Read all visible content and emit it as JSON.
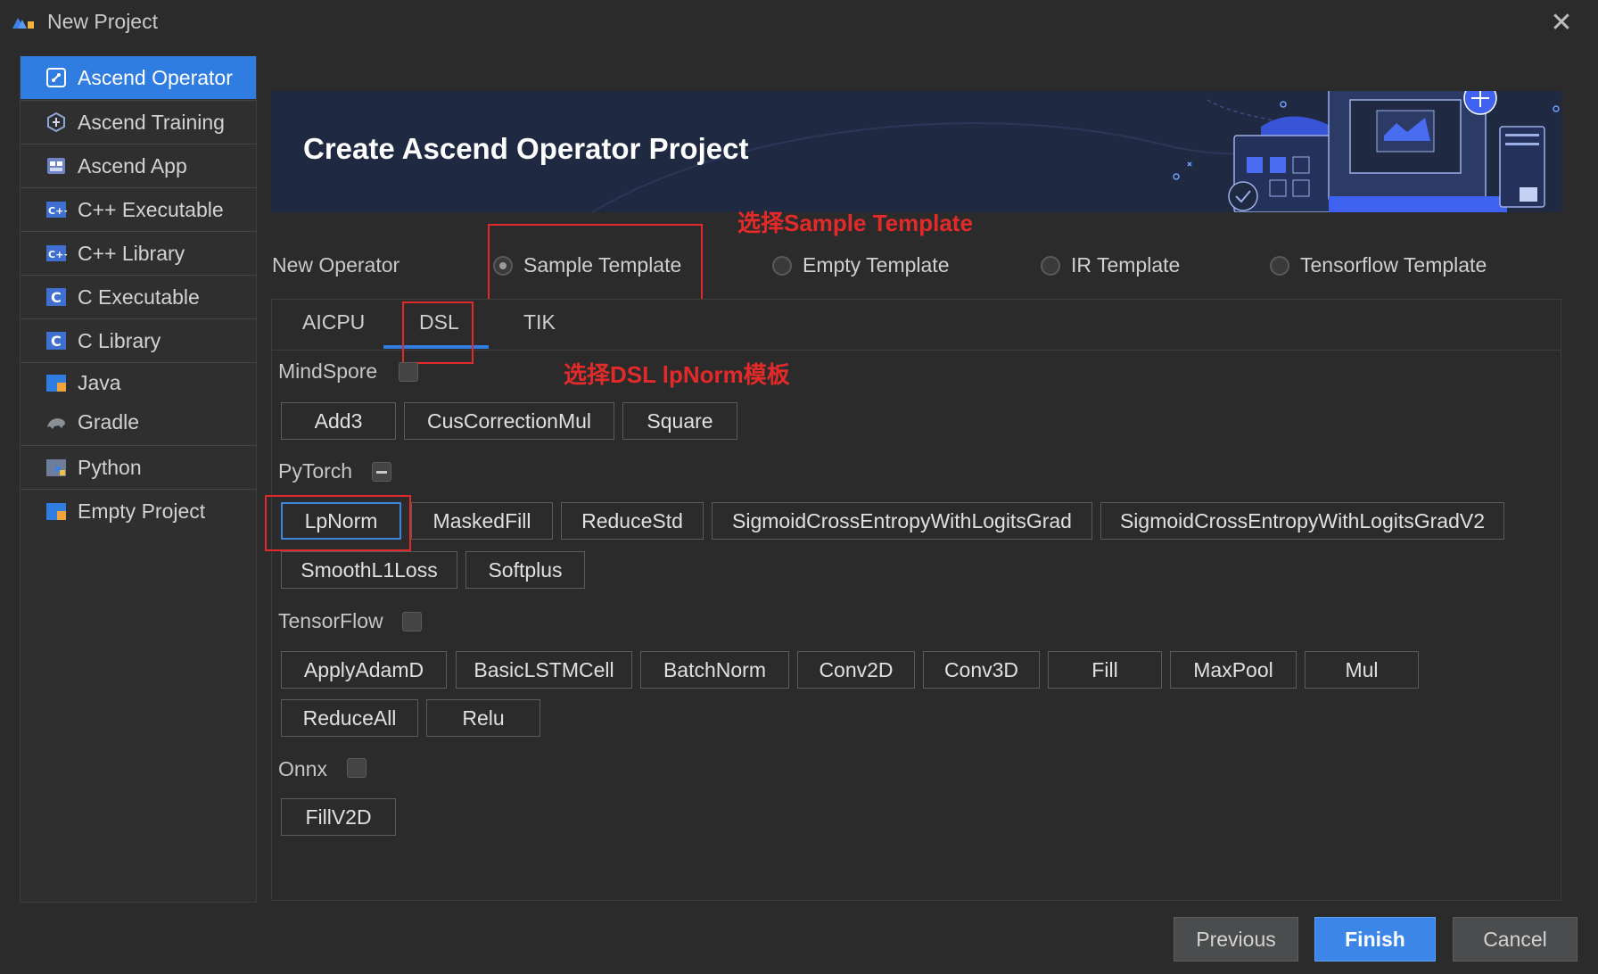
{
  "window": {
    "title": "New Project",
    "close_glyph": "✕"
  },
  "sidebar": {
    "items": [
      {
        "label": "Ascend Operator",
        "icon": "ascend-operator-icon",
        "selected": true
      },
      {
        "label": "Ascend Training",
        "icon": "ascend-training-icon"
      },
      {
        "label": "Ascend App",
        "icon": "ascend-app-icon"
      },
      {
        "label": "C++ Executable",
        "icon": "cpp-icon"
      },
      {
        "label": "C++ Library",
        "icon": "cpp-icon"
      },
      {
        "label": "C Executable",
        "icon": "c-icon"
      },
      {
        "label": "C Library",
        "icon": "c-icon"
      },
      {
        "label": "Java",
        "icon": "java-folder-icon"
      },
      {
        "label": "Gradle",
        "icon": "gradle-icon"
      },
      {
        "label": "Python",
        "icon": "python-icon"
      },
      {
        "label": "Empty Project",
        "icon": "empty-project-icon"
      }
    ]
  },
  "banner": {
    "title": "Create Ascend Operator Project"
  },
  "annotations": {
    "sample_template": "选择Sample Template",
    "dsl_lpnorm": "选择DSL lpNorm模板"
  },
  "new_operator": {
    "label": "New Operator",
    "options": [
      "Sample Template",
      "Empty Template",
      "IR Template",
      "Tensorflow Template"
    ],
    "selected": "Sample Template"
  },
  "tabs": {
    "items": [
      "AICPU",
      "DSL",
      "TIK"
    ],
    "active": "DSL"
  },
  "categories": {
    "mindspore": {
      "label": "MindSpore",
      "ops": [
        "Add3",
        "CusCorrectionMul",
        "Square"
      ]
    },
    "pytorch": {
      "label": "PyTorch",
      "ops": [
        "LpNorm",
        "MaskedFill",
        "ReduceStd",
        "SigmoidCrossEntropyWithLogitsGrad",
        "SigmoidCrossEntropyWithLogitsGradV2",
        "SmoothL1Loss",
        "Softplus"
      ]
    },
    "tensorflow": {
      "label": "TensorFlow",
      "ops": [
        "ApplyAdamD",
        "BasicLSTMCell",
        "BatchNorm",
        "Conv2D",
        "Conv3D",
        "Fill",
        "MaxPool",
        "Mul",
        "ReduceAll",
        "Relu"
      ]
    },
    "onnx": {
      "label": "Onnx",
      "ops": [
        "FillV2D"
      ]
    }
  },
  "footer": {
    "previous": "Previous",
    "finish": "Finish",
    "cancel": "Cancel"
  },
  "colors": {
    "accent": "#2f7de1",
    "annotation_red": "#e32a2a",
    "banner_bg": "#1f2942"
  }
}
